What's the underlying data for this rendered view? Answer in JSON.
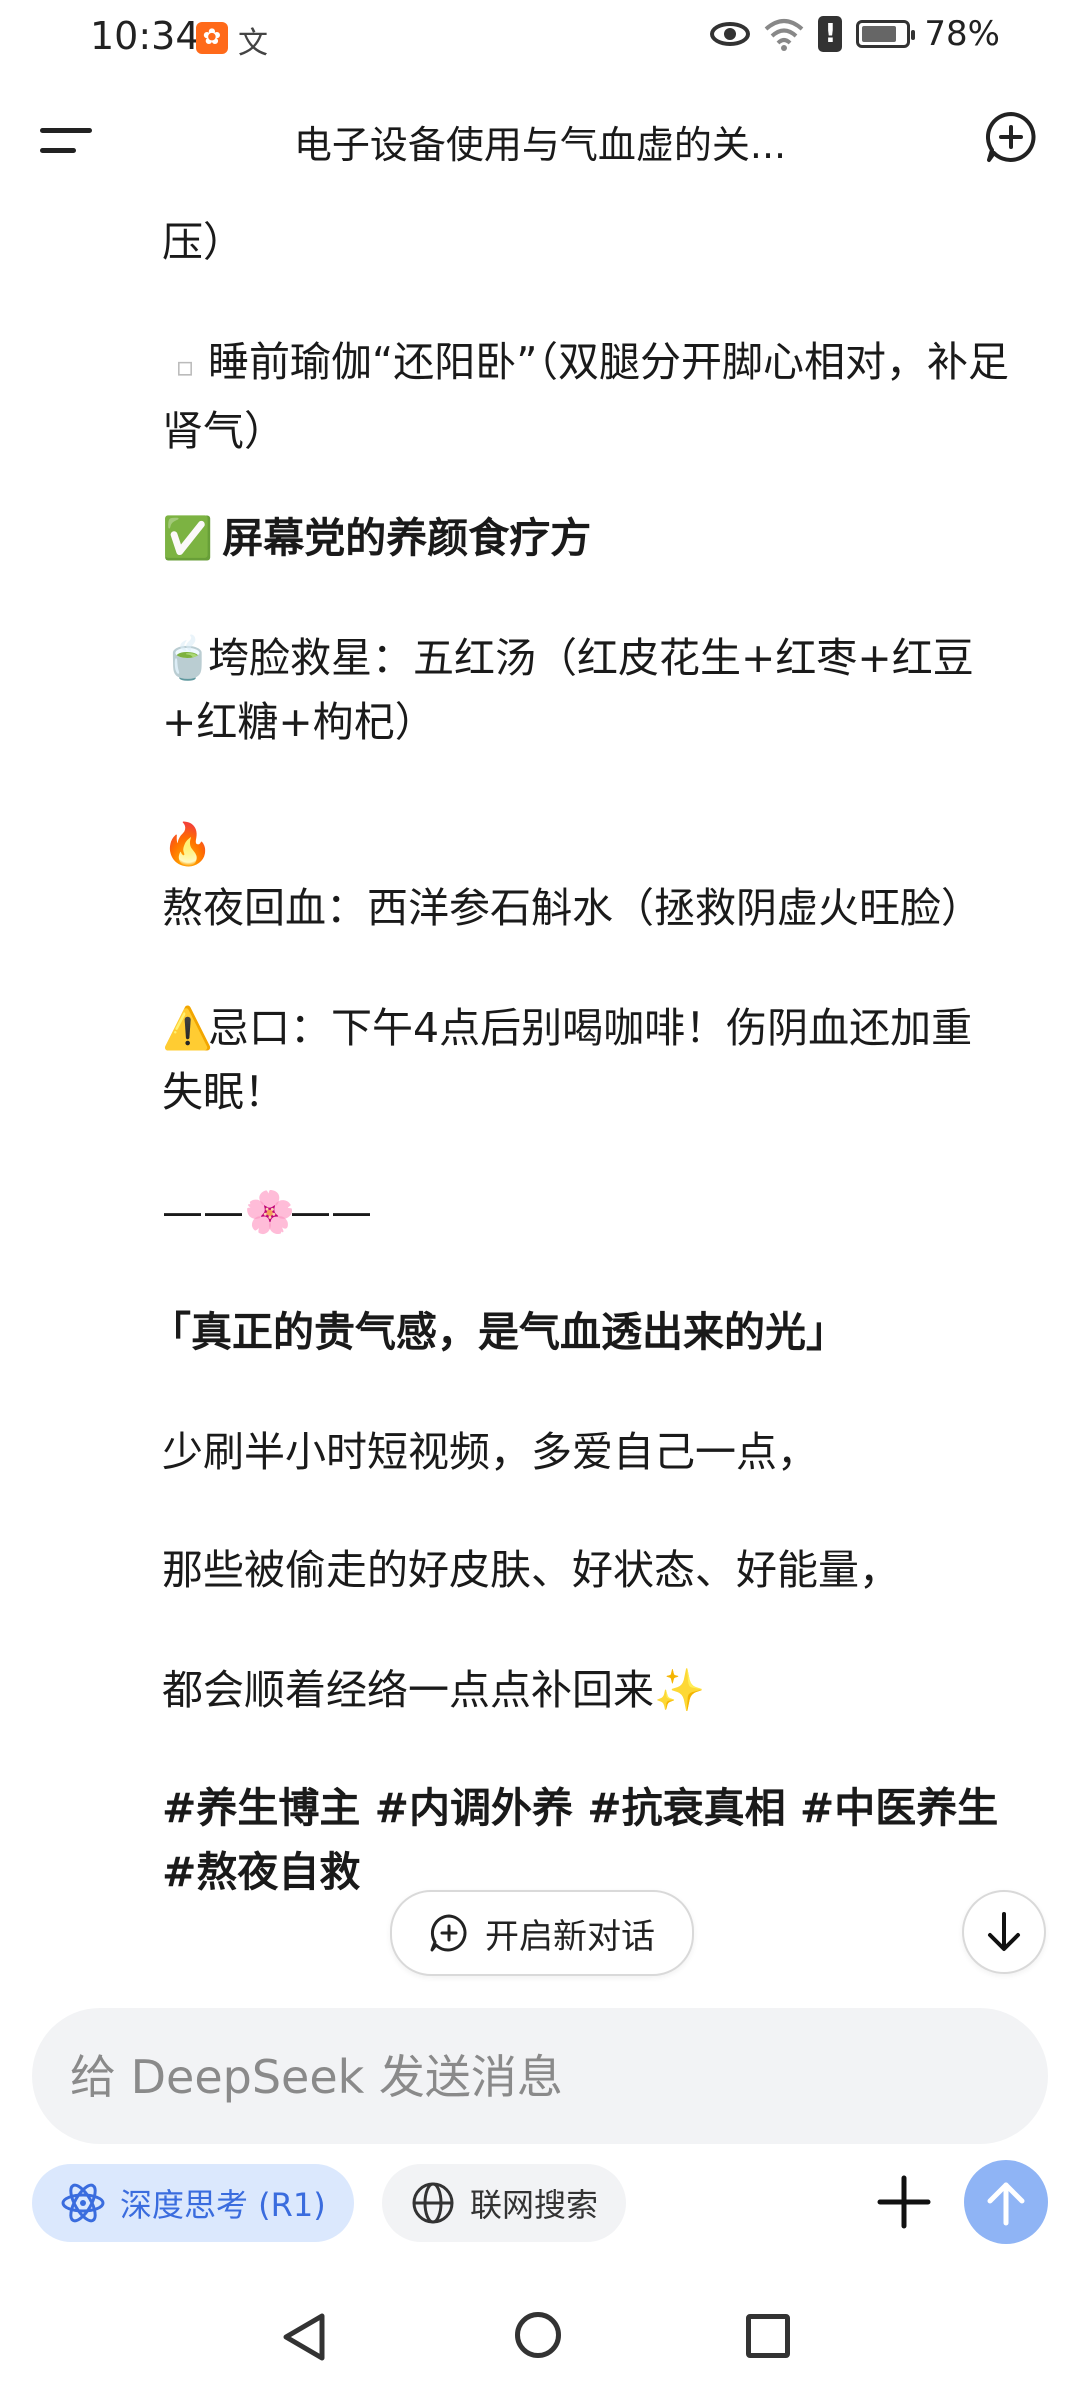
{
  "status_bar": {
    "time": "10:34",
    "battery": "78%",
    "icons": [
      "app-notification-icon",
      "translate-icon",
      "eye-icon",
      "wifi-icon",
      "alert-icon",
      "battery-icon"
    ]
  },
  "header": {
    "title": "电子设备使用与气血虚的关..."
  },
  "content": {
    "line_partial": "压）",
    "yoga_bullet": "▫",
    "yoga_line": "睡前瑜伽“还阳卧”（双腿分开脚心相对，补足肾气）",
    "section_icon": "✅",
    "section_title": "屏幕党的养颜食疗方",
    "tea_icon": "🍵",
    "tea_line": "垮脸救星：五红汤（红皮花生+红枣+红豆+红糖+枸杞）",
    "fire_icon": "🔥",
    "fire_line": "熬夜回血：西洋参石斛水（拯救阴虚火旺脸）",
    "warn_icon": "⚠️",
    "warn_line": "忌口：下午4点后别喝咖啡！伤阴血还加重失眠！",
    "divider_left": "——",
    "divider_icon": "🌸",
    "divider_right": "——",
    "quote": "「真正的贵气感，是气血透出来的光」",
    "line1": "少刷半小时短视频，多爱自己一点，",
    "line2": "那些被偷走的好皮肤、好状态、好能量，",
    "line3": "都会顺着经络一点点补回来",
    "sparkle_icon": "✨",
    "hashtags": "#养生博主 #内调外养 #抗衰真相 #中医养生 #熬夜自救"
  },
  "floating": {
    "new_chat_label": "开启新对话"
  },
  "composer": {
    "placeholder": "给 DeepSeek 发送消息",
    "deep_think_label": "深度思考 (R1)",
    "web_search_label": "联网搜索"
  },
  "colors": {
    "accent": "#3a6cde",
    "accent_chip_bg": "#dbe8fd",
    "send_button": "#8fb4f5",
    "input_bg": "#f2f3f5"
  }
}
